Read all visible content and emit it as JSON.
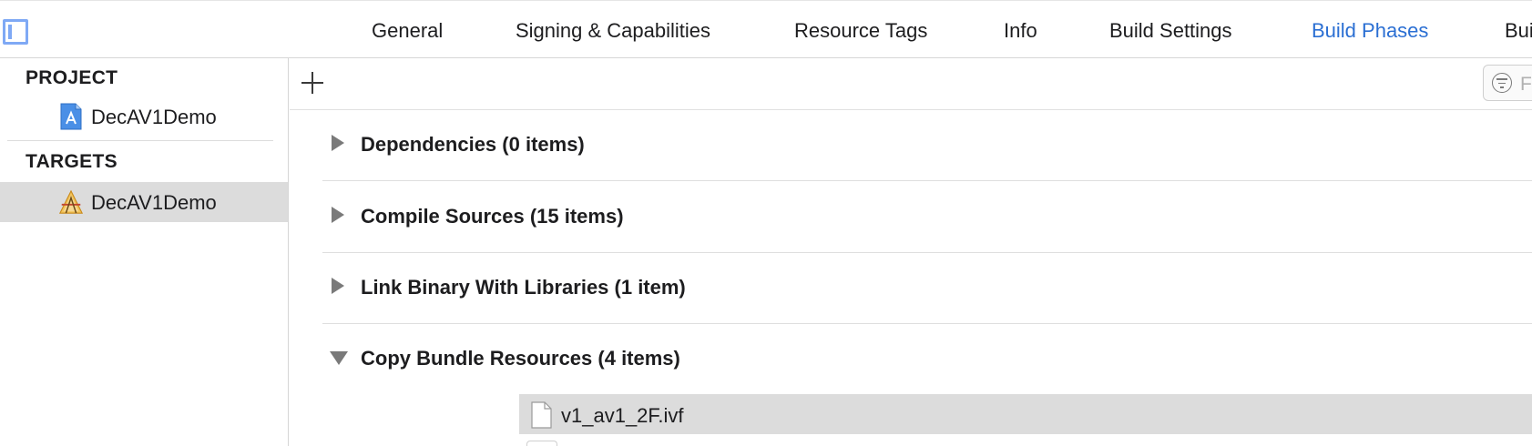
{
  "tabs": [
    {
      "label": "General"
    },
    {
      "label": "Signing & Capabilities"
    },
    {
      "label": "Resource Tags"
    },
    {
      "label": "Info"
    },
    {
      "label": "Build Settings"
    },
    {
      "label": "Build Phases",
      "active": true
    },
    {
      "label": "Bui"
    }
  ],
  "sidebar": {
    "project_header": "PROJECT",
    "project_item": {
      "label": "DecAV1Demo",
      "icon": "project-file-icon"
    },
    "targets_header": "TARGETS",
    "target_item": {
      "label": "DecAV1Demo",
      "icon": "app-target-icon",
      "selected": true
    }
  },
  "toolbar": {
    "add_icon": "plus-icon",
    "filter_placeholder": "F",
    "filter_icon": "filter-icon"
  },
  "phases": [
    {
      "title": "Dependencies (0 items)",
      "expanded": false
    },
    {
      "title": "Compile Sources (15 items)",
      "expanded": false
    },
    {
      "title": "Link Binary With Libraries (1 item)",
      "expanded": false
    },
    {
      "title": "Copy Bundle Resources (4 items)",
      "expanded": true
    }
  ],
  "resources": [
    {
      "name": "v1_av1_2F.ivf",
      "icon": "document-icon",
      "selected": true
    }
  ],
  "colors": {
    "accent": "#2b6fd3",
    "selection": "#dcdcdc",
    "disclosure": "#7a7a7a"
  }
}
